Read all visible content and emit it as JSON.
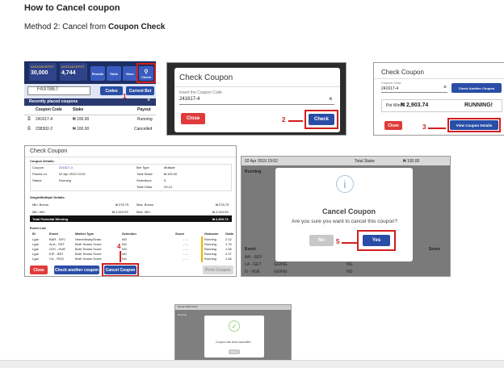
{
  "doc": {
    "title": "How to Cancel coupon",
    "method_prefix": "Method 2: Cancel from ",
    "method_bold": "Coupon Check"
  },
  "shot1": {
    "jackpot_left": "30,000",
    "jackpot_right": "4,744",
    "jackpot_label_left": "ALEXJACKPOT",
    "jackpot_label_right": "ALEXJACKPOT",
    "nav": [
      "Results",
      "Table",
      "More",
      "Check"
    ],
    "search_value": "FASTBET",
    "codes_label": "Codes",
    "current_bet_label": "Current Bet",
    "recent_label": "Recently placed coupons",
    "headers": [
      "Coupon Code",
      "Stake",
      "Payout"
    ],
    "rows": [
      {
        "code": "241617-4",
        "stake": "₦ 100.00",
        "payout": "Running"
      },
      {
        "code": "238302-2",
        "stake": "₦ 100.00",
        "payout": "Cancelled"
      }
    ],
    "step": "1"
  },
  "shot2": {
    "title": "Check Coupon",
    "insert_label": "Insert the Coupon Code",
    "code_value": "241617-4",
    "clear_glyph": "×",
    "close_label": "Close",
    "check_label": "Check",
    "step": "2"
  },
  "shot3": {
    "title": "Check Coupon",
    "code_label": "Coupon Code",
    "code_value": "241617-4",
    "clear_glyph": "×",
    "check_another_label": "Check Another Coupon",
    "pot_win_label": "Pot Win:",
    "pot_win_value": "₦ 2,903.74",
    "status": "RUNNING!",
    "close_label": "Close",
    "view_label": "View Coupon Details",
    "step": "3"
  },
  "shot4": {
    "title": "Check Coupon",
    "details_label": "Coupon Details:",
    "fields_left": [
      {
        "k": "Coupon",
        "v": "241617-4"
      },
      {
        "k": "Placed on",
        "v": "02 Apr 2019 19:52"
      },
      {
        "k": "Status",
        "v": "Running"
      }
    ],
    "fields_right": [
      {
        "k": "Bet Type",
        "v": "Multiple"
      },
      {
        "k": "Total Stake",
        "v": "₦ 100.00"
      },
      {
        "k": "Selections",
        "v": "5"
      },
      {
        "k": "Total Odds",
        "v": "29.24"
      }
    ],
    "single_label": "Single/Multiple Details:",
    "bonus_rows": [
      {
        "k1": "Min. Bonus",
        "v1": "₦ 378.75",
        "k2": "Max. Bonus",
        "v2": "₦ 378.75"
      },
      {
        "k1": "Min. Win",
        "v1": "₦ 2,524.99",
        "k2": "Max. Win",
        "v2": "₦ 2,524.99"
      }
    ],
    "total_label": "Total Potential Winning",
    "total_value": "₦ 2,903.74",
    "event_list_label": "Event List:",
    "event_headers": [
      "ID",
      "Event",
      "Market Type",
      "Selection",
      "Score",
      "Outcome",
      "Odds"
    ],
    "events": [
      {
        "id": "Lgal",
        "event": "BAR - SEV",
        "market": "Home/Away/Draw",
        "sel": "NG",
        "score": "- : -",
        "out": "Running",
        "odds": "2.12"
      },
      {
        "id": "Lgal",
        "event": "ALA - GET",
        "market": "Both Teams Score",
        "sel": "NG",
        "score": "- : -",
        "out": "Running",
        "odds": "1.79"
      },
      {
        "id": "Lgal",
        "event": "LEG - HUE",
        "market": "Both Teams Score",
        "sel": "NG",
        "score": "- : -",
        "out": "Running",
        "odds": "1.56"
      },
      {
        "id": "Lgal",
        "event": "EIP - BET",
        "market": "Both Teams Score",
        "sel": "NG",
        "score": "- : -",
        "out": "Running",
        "odds": "2.07"
      },
      {
        "id": "Lgal",
        "event": "VIL - RSO",
        "market": "Both Teams Score",
        "sel": "NG",
        "score": "- : -",
        "out": "Running",
        "odds": "1.84"
      }
    ],
    "close_label": "Close",
    "check_another_label": "Check another coupon",
    "cancel_label": "Cancel Coupon",
    "print_label": "Print Coupon",
    "step": "4"
  },
  "shot5": {
    "date": "02 Apr 2019 19:52",
    "stake_label": "Total Stake",
    "stake_value": "₦ 100.00",
    "running": "Running",
    "dialog_title": "Cancel Coupon",
    "dialog_text": "Are you sure you want to cancel this coupon?",
    "no_label": "No",
    "yes_label": "Yes",
    "info_glyph": "i",
    "bg_rows": [
      {
        "ev": "AR - SEV",
        "m": "",
        "s": "NG"
      },
      {
        "ev": "LA - GET",
        "m": "GG/NG",
        "s": "NG"
      },
      {
        "ev": "G - HUE",
        "m": "GG/NG",
        "s": "NG"
      }
    ],
    "event_label": "Event",
    "score_label": "Score",
    "step": "5"
  },
  "shot6": {
    "message": "Coupon has been cancelled",
    "ok_label": "Close",
    "check_glyph": "✓",
    "bg_date": "02 Apr 2019 19:52",
    "bg_label": "Running"
  }
}
